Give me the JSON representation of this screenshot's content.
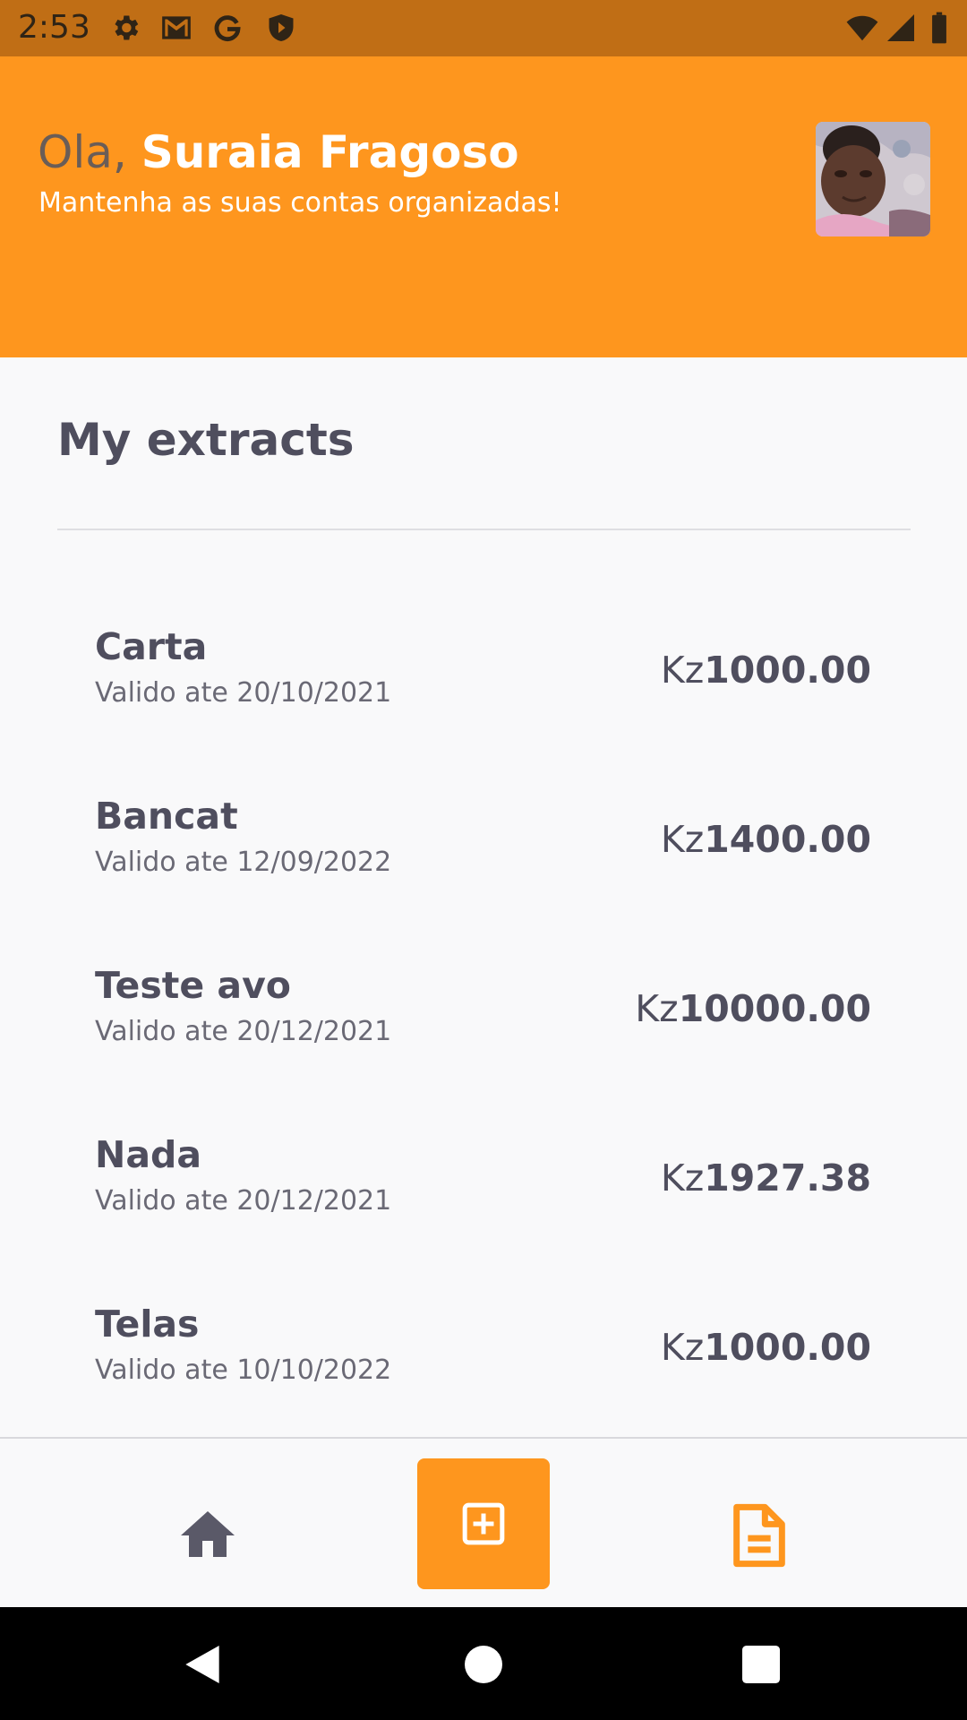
{
  "status_bar": {
    "time": "2:53",
    "left_icons": [
      "gear-icon",
      "gmail-icon",
      "google-g-icon",
      "shield-icon"
    ],
    "right_icons": [
      "wifi-icon",
      "signal-icon",
      "battery-icon"
    ]
  },
  "header": {
    "greeting_prefix": "Ola,",
    "user_name": "Suraia Fragoso",
    "subtitle": "Mantenha as suas contas organizadas!",
    "avatar_icon": "user-avatar-photo"
  },
  "main": {
    "title": "My extracts",
    "extracts": [
      {
        "name": "Carta",
        "valid_until": "Valido ate 20/10/2021",
        "currency": "Kz",
        "amount": "1000.00"
      },
      {
        "name": "Bancat",
        "valid_until": "Valido ate 12/09/2022",
        "currency": "Kz",
        "amount": "1400.00"
      },
      {
        "name": "Teste avo",
        "valid_until": "Valido ate 20/12/2021",
        "currency": "Kz",
        "amount": "10000.00"
      },
      {
        "name": "Nada",
        "valid_until": "Valido ate 20/12/2021",
        "currency": "Kz",
        "amount": "1927.38"
      },
      {
        "name": "Telas",
        "valid_until": "Valido ate 10/10/2022",
        "currency": "Kz",
        "amount": "1000.00"
      }
    ]
  },
  "bottom_nav": {
    "items": [
      {
        "icon": "home-icon"
      },
      {
        "icon": "add-box-icon"
      },
      {
        "icon": "document-icon"
      }
    ]
  },
  "colors": {
    "accent": "#fe961e",
    "status_bar": "#c06e15",
    "text_dark": "#4f4e5e",
    "text_muted": "#6a6975",
    "background": "#f9f9fa"
  }
}
